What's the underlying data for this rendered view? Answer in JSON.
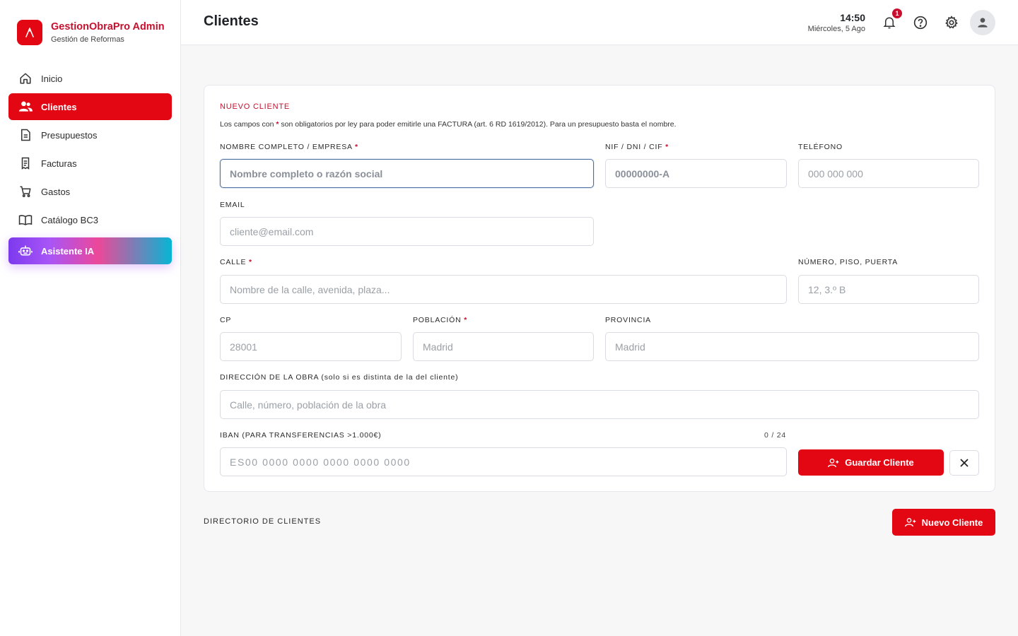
{
  "brand": {
    "title": "GestionObraPro Admin",
    "subtitle": "Gestión de Reformas",
    "logo_letter": "Λ"
  },
  "sidebar": {
    "items": [
      {
        "label": "Inicio",
        "icon": "home-icon"
      },
      {
        "label": "Clientes",
        "icon": "users-icon",
        "active": true
      },
      {
        "label": "Presupuestos",
        "icon": "document-icon"
      },
      {
        "label": "Facturas",
        "icon": "receipt-icon"
      },
      {
        "label": "Gastos",
        "icon": "cart-icon"
      },
      {
        "label": "Catálogo BC3",
        "icon": "book-icon"
      },
      {
        "label": "Asistente IA",
        "icon": "robot-icon"
      }
    ]
  },
  "header": {
    "title": "Clientes",
    "time": "14:50",
    "date": "Miércoles, 5 Ago",
    "notification_count": "1"
  },
  "form": {
    "section_title": "NUEVO CLIENTE",
    "note_pre": "Los campos con ",
    "note_star": "*",
    "note_post": " son obligatorios por ley para poder emitirle una FACTURA (art. 6 RD 1619/2012). Para un presupuesto basta el nombre.",
    "name_label": "NOMBRE COMPLETO / EMPRESA",
    "name_placeholder": "Nombre completo o razón social",
    "nif_label": "NIF / DNI / CIF",
    "nif_placeholder": "00000000-A",
    "phone_label": "TELÉFONO",
    "phone_placeholder": "000 000 000",
    "email_label": "EMAIL",
    "email_placeholder": "cliente@email.com",
    "street_label": "CALLE",
    "street_placeholder": "Nombre de la calle, avenida, plaza...",
    "number_label": "NÚMERO, PISO, PUERTA",
    "number_placeholder": "12, 3.º B",
    "cp_label": "CP",
    "cp_placeholder": "28001",
    "city_label": "POBLACIÓN",
    "city_placeholder": "Madrid",
    "province_label": "PROVINCIA",
    "province_placeholder": "Madrid",
    "site_label": "DIRECCIÓN DE LA OBRA (solo si es distinta de la del cliente)",
    "site_placeholder": "Calle, número, población de la obra",
    "iban_label": "IBAN (PARA TRANSFERENCIAS >1.000€)",
    "iban_counter": "0 / 24",
    "iban_placeholder": "ES00 0000 0000 0000 0000 0000",
    "required_mark": "*",
    "save_label": "Guardar Cliente"
  },
  "directory": {
    "title": "DIRECTORIO DE CLIENTES",
    "new_label": "Nuevo Cliente"
  },
  "colors": {
    "accent": "#e30613",
    "brand_text": "#c8102e",
    "focus_border": "#4a6fa5"
  }
}
